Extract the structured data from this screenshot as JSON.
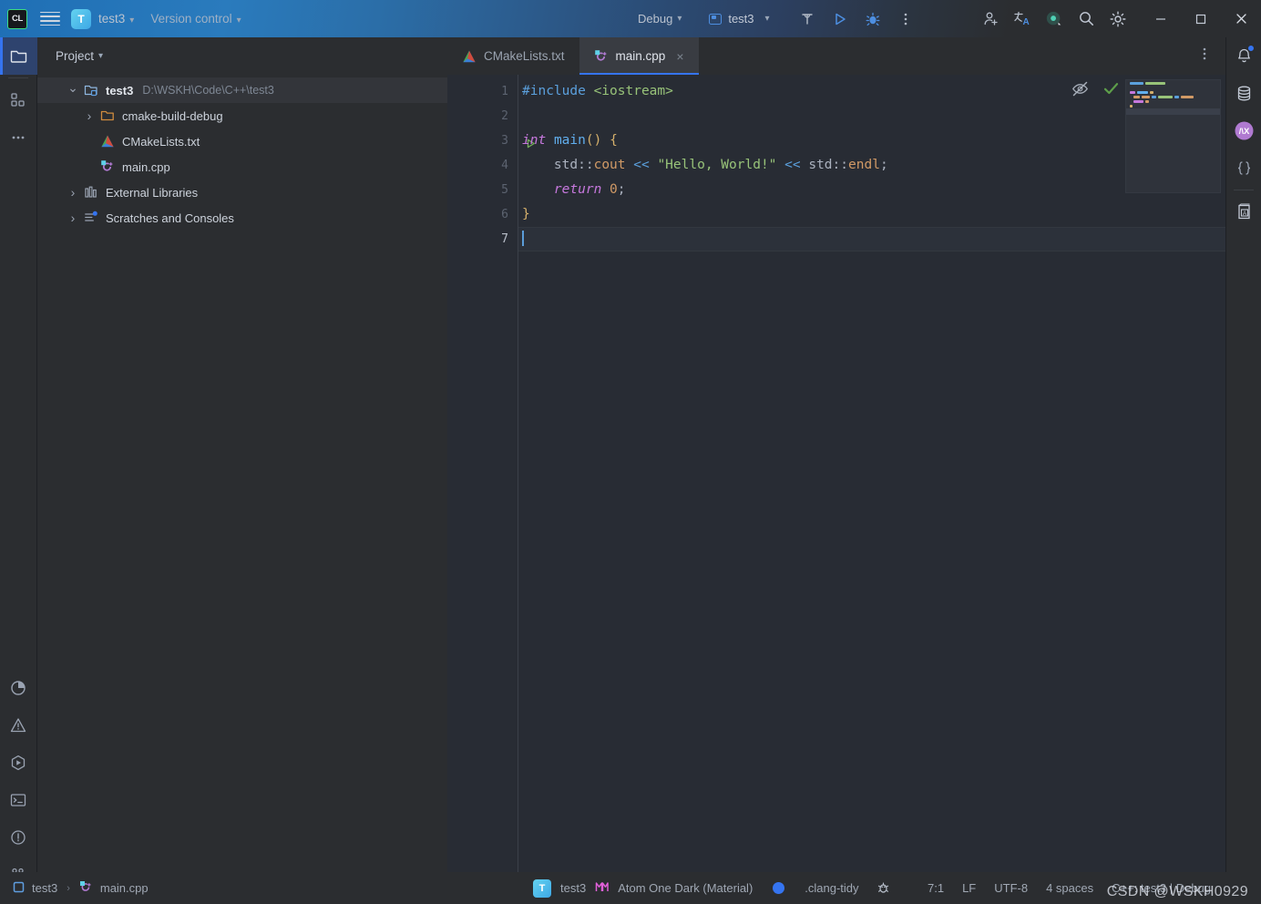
{
  "titlebar": {
    "logo": "CL",
    "menu_icon": "hamburger-menu-icon",
    "project_initial": "T",
    "project_name": "test3",
    "version_control": "Version control",
    "debug_label": "Debug",
    "run_config": "test3",
    "icons": [
      "build-hammer-icon",
      "run-icon",
      "debug-icon",
      "more-options-icon",
      "add-collaborator-icon",
      "translate-icon",
      "ai-assistant-icon",
      "search-icon",
      "settings-gear-icon"
    ],
    "window_buttons": [
      "minimize",
      "maximize",
      "close"
    ]
  },
  "left_rail": {
    "top_items": [
      {
        "name": "project-tool-window",
        "icon": "folder-icon",
        "active": true
      },
      {
        "name": "commit-tool-window",
        "icon": "grid-squares-icon",
        "active": false
      },
      {
        "name": "more-tool-windows",
        "icon": "ellipsis-icon",
        "active": false
      }
    ],
    "bottom_items": [
      {
        "name": "profiler-tool-window",
        "icon": "pie-chart-icon"
      },
      {
        "name": "problems-tool-window",
        "icon": "warning-triangle-icon"
      },
      {
        "name": "run-tool-window",
        "icon": "run-hex-icon"
      },
      {
        "name": "terminal-tool-window",
        "icon": "terminal-icon"
      },
      {
        "name": "services-tool-window",
        "icon": "exclamation-circle-icon"
      },
      {
        "name": "version-control-tool-window",
        "icon": "git-branch-icon"
      }
    ]
  },
  "right_rail": {
    "items": [
      {
        "name": "notifications",
        "icon": "bell-icon",
        "badge": true
      },
      {
        "name": "database",
        "icon": "database-icon",
        "badge": false
      },
      {
        "name": "ai-assistant",
        "icon": "ai-avatar-icon",
        "badge": false
      },
      {
        "name": "json-tools",
        "icon": "curly-braces-icon",
        "badge": false
      },
      {
        "name": "translation",
        "icon": "book-a-icon",
        "badge": false
      }
    ]
  },
  "project_panel": {
    "header": "Project",
    "header_chevron": "chevron-down-icon",
    "tree": [
      {
        "label": "test3",
        "path": "D:\\WSKH\\Code\\C++\\test3",
        "icon": "project-folder-icon",
        "expanded": true,
        "selected": true,
        "depth": 0,
        "bold": true
      },
      {
        "label": "cmake-build-debug",
        "path": "",
        "icon": "folder-icon",
        "expanded": false,
        "selected": false,
        "depth": 1,
        "bold": false
      },
      {
        "label": "CMakeLists.txt",
        "path": "",
        "icon": "cmake-icon",
        "expanded": null,
        "selected": false,
        "depth": 1,
        "bold": false
      },
      {
        "label": "main.cpp",
        "path": "",
        "icon": "cpp-file-icon",
        "expanded": null,
        "selected": false,
        "depth": 1,
        "bold": false
      },
      {
        "label": "External Libraries",
        "path": "",
        "icon": "libraries-icon",
        "expanded": false,
        "selected": false,
        "depth": 0,
        "bold": false
      },
      {
        "label": "Scratches and Consoles",
        "path": "",
        "icon": "scratches-icon",
        "expanded": false,
        "selected": false,
        "depth": 0,
        "bold": false
      }
    ]
  },
  "editor": {
    "tabs": [
      {
        "label": "CMakeLists.txt",
        "icon": "cmake-icon",
        "active": false,
        "closable": false
      },
      {
        "label": "main.cpp",
        "icon": "cpp-file-icon",
        "active": true,
        "closable": true
      }
    ],
    "tabbar_more": "more-options-icon",
    "inspections_icon": "inspections-off-eye-icon",
    "analysis_status_icon": "checkmark-ok-icon",
    "line_numbers": [
      "1",
      "2",
      "3",
      "4",
      "5",
      "6",
      "7"
    ],
    "current_line": 7,
    "run_gutter_line": 3,
    "code_lines": [
      [
        {
          "t": "#include ",
          "c": "pp"
        },
        {
          "t": "<iostream>",
          "c": "inc"
        }
      ],
      [],
      [
        {
          "t": "int",
          "c": "kw"
        },
        {
          "t": " ",
          "c": "id"
        },
        {
          "t": "main",
          "c": "fn"
        },
        {
          "t": "()",
          "c": "br"
        },
        {
          "t": " ",
          "c": "id"
        },
        {
          "t": "{",
          "c": "br"
        }
      ],
      [
        {
          "t": "    ",
          "c": "id"
        },
        {
          "t": "std",
          "c": "id"
        },
        {
          "t": "::",
          "c": "id"
        },
        {
          "t": "cout",
          "c": "mem"
        },
        {
          "t": " ",
          "c": "id"
        },
        {
          "t": "<<",
          "c": "shiftop"
        },
        {
          "t": " ",
          "c": "id"
        },
        {
          "t": "\"Hello, World!\"",
          "c": "str"
        },
        {
          "t": " ",
          "c": "id"
        },
        {
          "t": "<<",
          "c": "shiftop"
        },
        {
          "t": " ",
          "c": "id"
        },
        {
          "t": "std",
          "c": "id"
        },
        {
          "t": "::",
          "c": "id"
        },
        {
          "t": "endl",
          "c": "mem"
        },
        {
          "t": ";",
          "c": "id"
        }
      ],
      [
        {
          "t": "    ",
          "c": "id"
        },
        {
          "t": "return",
          "c": "kw"
        },
        {
          "t": " ",
          "c": "id"
        },
        {
          "t": "0",
          "c": "num"
        },
        {
          "t": ";",
          "c": "id"
        }
      ],
      [
        {
          "t": "}",
          "c": "br"
        }
      ],
      []
    ]
  },
  "statusbar": {
    "breadcrumb": [
      {
        "label": "test3",
        "icon": "module-icon"
      },
      {
        "label": "main.cpp",
        "icon": "cpp-file-icon"
      }
    ],
    "breadcrumb_separator": "›",
    "project_initial": "T",
    "project_name": "test3",
    "theme_icon": "material-theme-icon",
    "theme_name": "Atom One Dark (Material)",
    "indicator_icon": "blue-circle-indicator",
    "clang_tidy": ".clang-tidy",
    "inspection_icon": "bug-inspection-icon",
    "caret_position": "7:1",
    "line_separator": "LF",
    "encoding": "UTF-8",
    "indent": "4 spaces",
    "toolchain": "C++: test3 | Debug"
  },
  "watermark": "CSDN @WSKH0929",
  "colors": {
    "editor_bg": "#282c34",
    "panel_bg": "#2b2d30",
    "accent_blue": "#3574f0",
    "keyword_purple": "#c678dd",
    "string_green": "#98c379",
    "function_blue": "#61afef",
    "number_orange": "#d19a66",
    "brace_gold": "#d5b06b"
  }
}
